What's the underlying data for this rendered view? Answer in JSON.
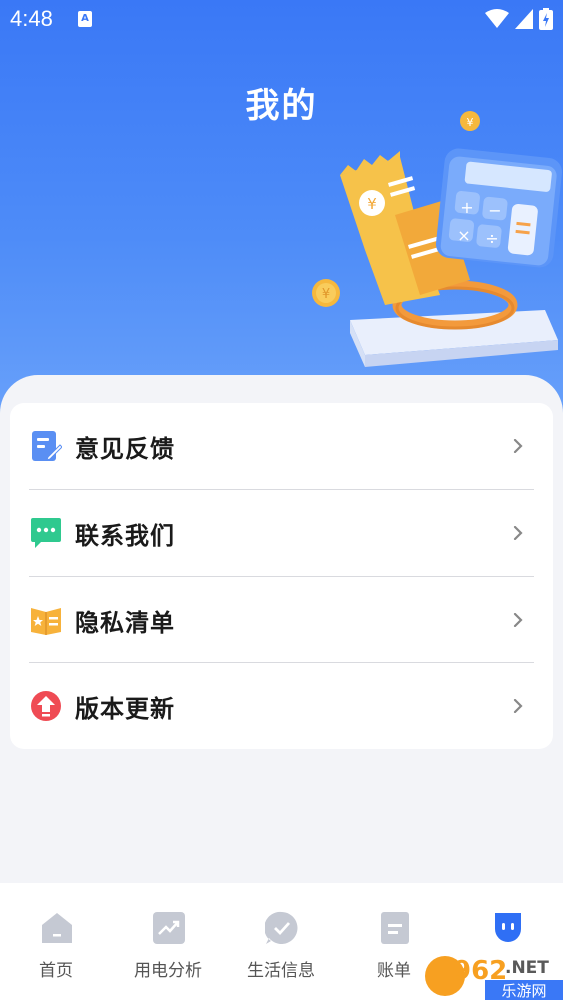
{
  "status_bar": {
    "time": "4:48",
    "notification_glyph": "A"
  },
  "page": {
    "title": "我的"
  },
  "menu": {
    "items": [
      {
        "label": "意见反馈",
        "icon": "feedback-icon"
      },
      {
        "label": "联系我们",
        "icon": "chat-icon"
      },
      {
        "label": "隐私清单",
        "icon": "privacy-book-icon"
      },
      {
        "label": "版本更新",
        "icon": "upgrade-icon"
      }
    ]
  },
  "bottom_nav": {
    "items": [
      {
        "label": "首页",
        "icon": "home-icon",
        "active": false
      },
      {
        "label": "用电分析",
        "icon": "trend-chart-icon",
        "active": false
      },
      {
        "label": "生活信息",
        "icon": "check-bubble-icon",
        "active": false
      },
      {
        "label": "账单",
        "icon": "bill-icon",
        "active": false
      },
      {
        "label": "",
        "icon": "profile-face-icon",
        "active": true
      }
    ]
  },
  "watermark": {
    "text_top": "962.NET",
    "text_bottom": "乐游网"
  },
  "colors": {
    "primary": "#3a78f6",
    "nav_active": "#2f6ff5",
    "nav_inactive": "#c5c9d3"
  }
}
